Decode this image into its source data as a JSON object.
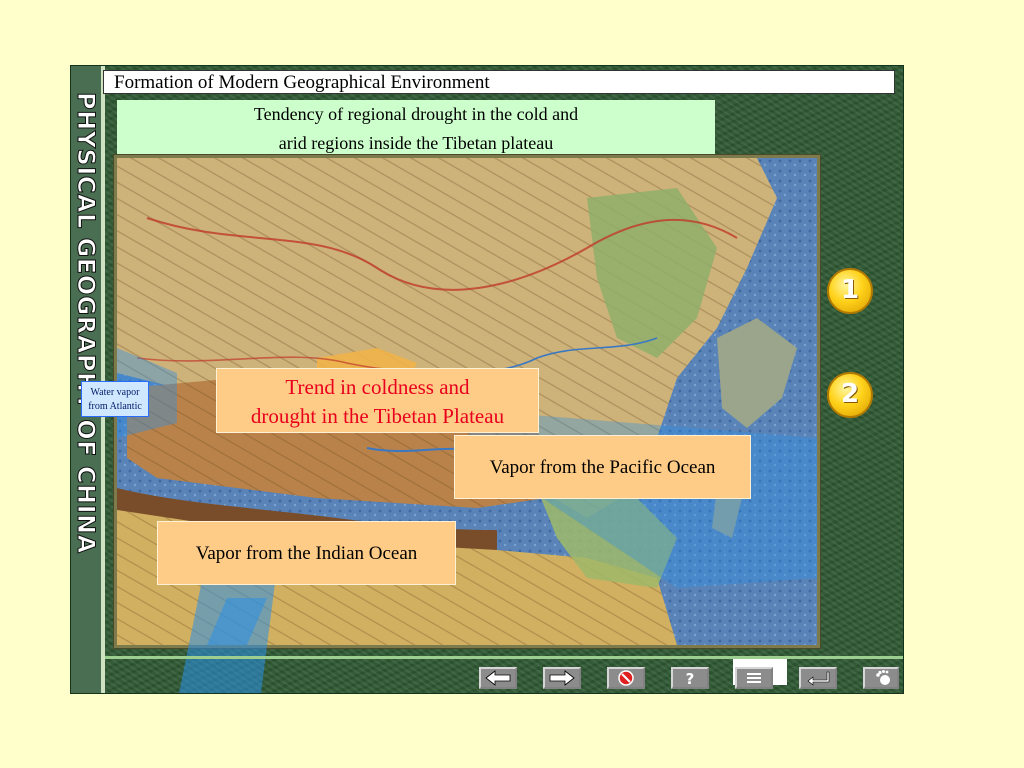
{
  "spine_title": "PHYSICAL GEOGRAPHY OF CHINA",
  "header": {
    "title": "Formation of Modern Geographical Environment"
  },
  "subtitle": {
    "line1": "Tendency of regional drought in the cold and",
    "line2": "arid regions inside the Tibetan plateau"
  },
  "callouts": {
    "main_line1": "Trend in coldness and",
    "main_line2": "drought in the Tibetan Plateau",
    "pacific": "Vapor from the Pacific Ocean",
    "indian": "Vapor from the Indian Ocean",
    "atlantic_line1": "Water vapor",
    "atlantic_line2": "from Atlantic"
  },
  "number_buttons": [
    "1",
    "2"
  ],
  "nav_buttons": [
    "back-arrow-icon",
    "forward-arrow-icon",
    "exit-icon",
    "help-icon",
    "menu-icon",
    "return-icon",
    "footprint-icon"
  ],
  "help_label": "?",
  "colors": {
    "background": "#ffffcc",
    "frame_green": "#2f5a34",
    "callout_fill": "#ffcc88",
    "callout_main_text": "#e8001c",
    "subtitle_fill": "#ccffcc",
    "number_button": "#ffd21a"
  }
}
